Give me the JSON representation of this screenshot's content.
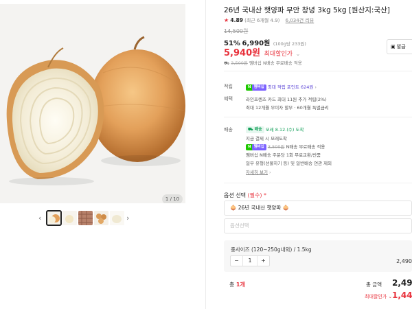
{
  "product": {
    "title": "26년 국내산 햇양파 무안 창녕 3kg 5kg [원산지:국산]",
    "rating_score": "4.89",
    "rating_detail": "(최근 6개월 4.9)",
    "review_count": "6,034건 리뷰",
    "original_price": "14,500원",
    "discount_pct": "51%",
    "sale_price": "6,990원",
    "unit_price": "(100g당 233원)",
    "max_price": "5,940원",
    "max_label": "최대할인가",
    "coupon_label": "발급",
    "ship_line": {
      "strike": "3,500원",
      "rest": "멤버십 N배송 무료배송 적용"
    }
  },
  "image": {
    "counter": "1 / 10"
  },
  "thumbs": [
    "onion-whole",
    "onion-peeled",
    "onion-bag",
    "onion-small",
    "onion-half"
  ],
  "accumulate": {
    "label": "적립",
    "badge1": "N",
    "badge2": "멤버십",
    "text": "최대 적립 포인트 624원"
  },
  "benefit": {
    "label": "혜택",
    "line1": "라인프렌즈 카드 최대 11원 추가 적립(2%)",
    "line2": "최대 12개월 무이자 할부 · 60개월 특별금리"
  },
  "delivery": {
    "label": "배송",
    "badge": "배송",
    "arrival": "모레 8.12.(수) 도착",
    "line1": "지금 결제 시 모레도착",
    "line2_badge1": "N",
    "line2_badge2": "멤버십",
    "line2_strike": "3,500원",
    "line2_text": "N배송 무료배송 적용",
    "line3": "멤버십 N배송 주문당 1회 무료교환/반품",
    "line4": "일부 유형(선물하기 등) 및 일반배송 연관 제외",
    "detail_link": "자세히 보기"
  },
  "options": {
    "label": "옵션 선택",
    "required": "(필수) *",
    "selected": "26년 국내산 햇양파",
    "second_placeholder": "옵션선택"
  },
  "selection": {
    "name": "중사이즈 (120~250g내외) / 1.5kg",
    "qty": "1",
    "minus": "−",
    "plus": "+",
    "price": "2,490"
  },
  "total": {
    "count_label": "총",
    "count": "1개",
    "amount_label": "총 금액",
    "amount": "2,490",
    "max_label": "최대할인가",
    "max_amount": "1,440"
  },
  "colors": {
    "accent": "#e8323c",
    "naver_green": "#1ec800"
  }
}
